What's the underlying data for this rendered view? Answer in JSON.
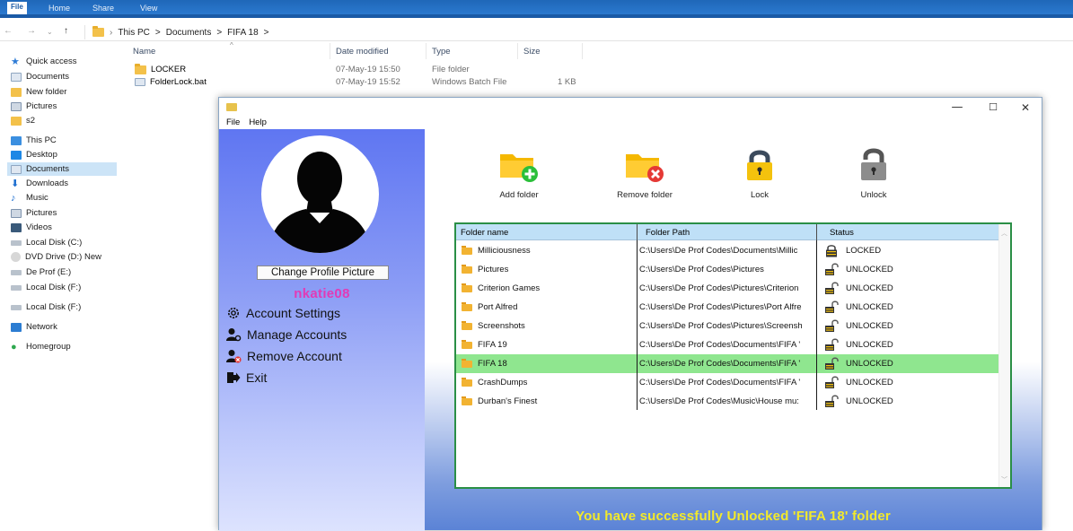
{
  "explorer": {
    "ribbon": {
      "file": "File",
      "home": "Home",
      "share": "Share",
      "view": "View"
    },
    "breadcrumb": [
      "This PC",
      ">",
      "Documents",
      ">",
      "FIFA 18",
      ">"
    ],
    "nav": {
      "quick_access": "Quick access",
      "documents": "Documents",
      "new_folder": "New folder",
      "pictures": "Pictures",
      "s2": "s2",
      "this_pc": "This PC",
      "desktop": "Desktop",
      "documents2": "Documents",
      "downloads": "Downloads",
      "music": "Music",
      "pictures2": "Pictures",
      "videos": "Videos",
      "local_c": "Local Disk (C:)",
      "dvd": "DVD Drive (D:) New",
      "deprof": "De Prof (E:)",
      "local_f": "Local Disk (F:)",
      "local_f2": "Local Disk (F:)",
      "network": "Network",
      "homegroup": "Homegroup"
    },
    "columns": {
      "name": "Name",
      "date": "Date modified",
      "type": "Type",
      "size": "Size"
    },
    "files": [
      {
        "name": "LOCKER",
        "date": "07-May-19 15:50",
        "type": "File folder",
        "size": ""
      },
      {
        "name": "FolderLock.bat",
        "date": "07-May-19 15:52",
        "type": "Windows Batch File",
        "size": "1 KB"
      }
    ]
  },
  "app": {
    "window": {
      "minimize": "—",
      "maximize": "☐",
      "close": "✕"
    },
    "menu": {
      "file": "File",
      "help": "Help"
    },
    "sidebar": {
      "change_picture": "Change Profile Picture",
      "username": "nkatie08",
      "account_settings": "Account Settings",
      "manage_accounts": "Manage Accounts",
      "remove_account": "Remove Account",
      "exit": "Exit"
    },
    "toolbar": {
      "add_folder": "Add folder",
      "remove_folder": "Remove folder",
      "lock": "Lock",
      "unlock": "Unlock"
    },
    "table": {
      "headers": {
        "name": "Folder name",
        "path": "Folder Path",
        "status": "Status"
      },
      "rows": [
        {
          "name": "Milliciousness",
          "path": "C:\\Users\\De Prof Codes\\Documents\\Millic",
          "status": "LOCKED"
        },
        {
          "name": "Pictures",
          "path": "C:\\Users\\De Prof Codes\\Pictures",
          "status": "UNLOCKED"
        },
        {
          "name": "Criterion Games",
          "path": "C:\\Users\\De Prof Codes\\Pictures\\Criterion",
          "status": "UNLOCKED"
        },
        {
          "name": "Port Alfred",
          "path": "C:\\Users\\De Prof Codes\\Pictures\\Port Alfre",
          "status": "UNLOCKED"
        },
        {
          "name": "Screenshots",
          "path": "C:\\Users\\De Prof Codes\\Pictures\\Screensh",
          "status": "UNLOCKED"
        },
        {
          "name": "FIFA 19",
          "path": "C:\\Users\\De Prof Codes\\Documents\\FIFA '",
          "status": "UNLOCKED"
        },
        {
          "name": "FIFA 18",
          "path": "C:\\Users\\De Prof Codes\\Documents\\FIFA '",
          "status": "UNLOCKED"
        },
        {
          "name": "CrashDumps",
          "path": "C:\\Users\\De Prof Codes\\Documents\\FIFA '",
          "status": "UNLOCKED"
        },
        {
          "name": "Durban's Finest",
          "path": "C:\\Users\\De Prof Codes\\Music\\House mu:",
          "status": "UNLOCKED"
        }
      ],
      "selected_row": 6
    },
    "message": "You have successfully Unlocked 'FIFA 18' folder"
  }
}
